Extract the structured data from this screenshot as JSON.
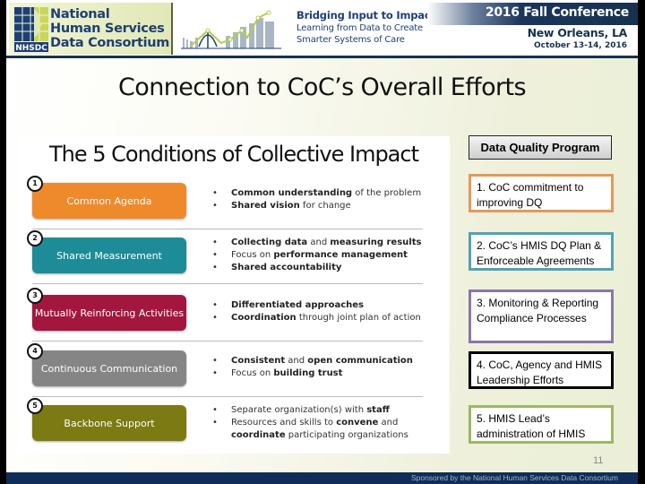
{
  "header": {
    "logo": {
      "lines": [
        "National",
        "Human Services",
        "Data Consortium"
      ],
      "abbreviation": "NHSDC"
    },
    "tagline": {
      "title": "Bridging Input to Impact",
      "line1": "Learning from Data to Create",
      "line2": "Smarter Systems of Care"
    },
    "conference": {
      "title": "2016 Fall Conference",
      "city": "New Orleans, LA",
      "dates": "October 13-14, 2016"
    }
  },
  "slide_title": "Connection to CoC’s Overall Efforts",
  "panel": {
    "title": "The 5 Conditions of Collective Impact",
    "conditions": [
      {
        "number": "1",
        "label": "Common Agenda",
        "color": "#ef8a2c",
        "bullets": [
          [
            {
              "b": "Common understanding"
            },
            {
              "t": " of the problem"
            }
          ],
          [
            {
              "b": "Shared vision"
            },
            {
              "t": " for change"
            }
          ]
        ]
      },
      {
        "number": "2",
        "label": "Shared Measurement",
        "color": "#1d8c98",
        "bullets": [
          [
            {
              "b": "Collecting data"
            },
            {
              "t": " and "
            },
            {
              "b": "measuring results"
            }
          ],
          [
            {
              "t": "Focus on "
            },
            {
              "b": "performance management"
            }
          ],
          [
            {
              "b": "Shared accountability"
            }
          ]
        ]
      },
      {
        "number": "3",
        "label": "Mutually Reinforcing Activities",
        "color": "#a3173f",
        "bullets": [
          [
            {
              "b": "Differentiated approaches"
            }
          ],
          [
            {
              "b": "Coordination"
            },
            {
              "t": " through joint plan of action"
            }
          ]
        ]
      },
      {
        "number": "4",
        "label": "Continuous Communication",
        "color": "#858585",
        "bullets": [
          [
            {
              "b": "Consistent"
            },
            {
              "t": " and "
            },
            {
              "b": "open communication"
            }
          ],
          [
            {
              "t": "Focus on "
            },
            {
              "b": "building trust"
            }
          ]
        ]
      },
      {
        "number": "5",
        "label": "Backbone Support",
        "color": "#7c7a12",
        "bullets": [
          [
            {
              "t": "Separate organization(s) with "
            },
            {
              "b": "staff"
            }
          ],
          [
            {
              "t": "Resources and skills to "
            },
            {
              "b": "convene"
            },
            {
              "t": " and"
            }
          ],
          [
            {
              "b": "coordinate"
            },
            {
              "t": " participating organizations"
            }
          ]
        ]
      }
    ]
  },
  "data_quality": {
    "header": "Data Quality Program",
    "items": [
      {
        "text": "1. CoC commitment to improving DQ",
        "border_color": "#e6985a"
      },
      {
        "text": "2. CoC’s HMIS DQ Plan & Enforceable Agreements",
        "border_color": "#4fa3b5"
      },
      {
        "text": "3. Monitoring & Reporting\nCompliance Processes",
        "border_color": "#8a76a8"
      },
      {
        "text": "4. CoC, Agency and HMIS Leadership Efforts",
        "border_color": "#000000"
      },
      {
        "text": "5. HMIS Lead’s administration of HMIS",
        "border_color": "#9bb866"
      }
    ]
  },
  "page_number": "11",
  "footer": {
    "text": "Sponsored by the National Human Services Data Consortium"
  }
}
